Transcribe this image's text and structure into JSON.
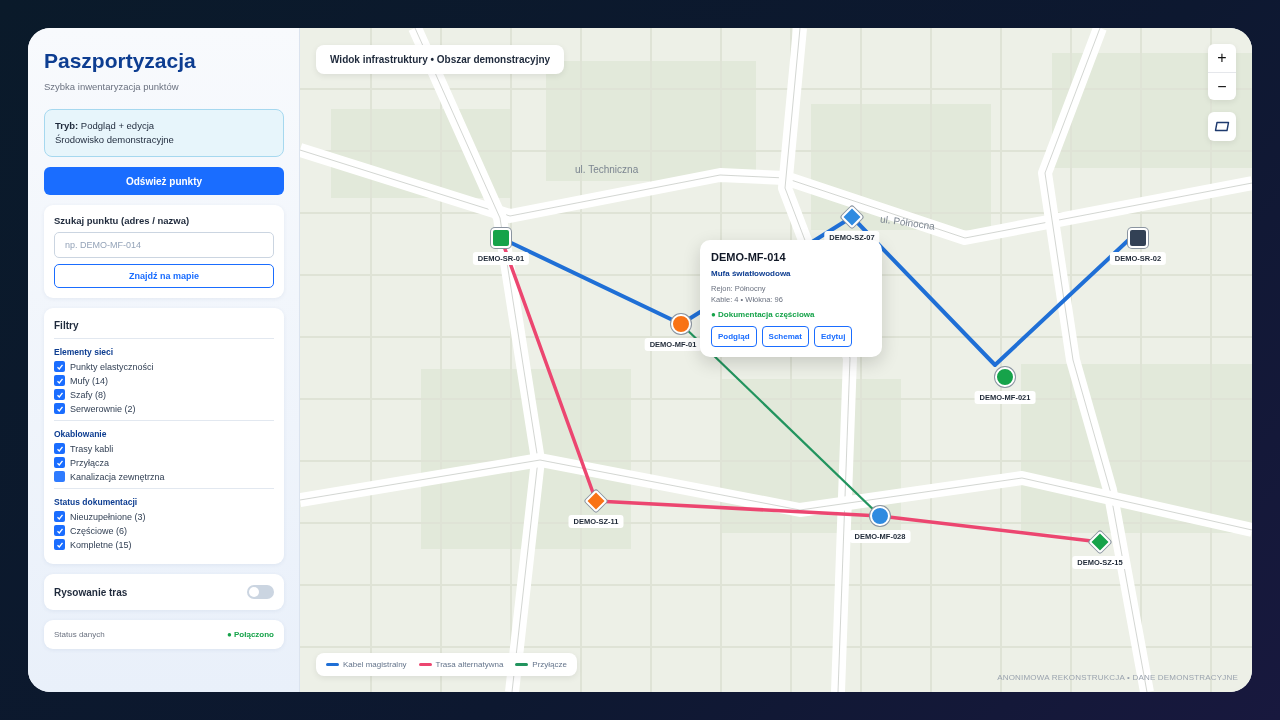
{
  "sidebar": {
    "title": "Paszportyzacja",
    "subtitle": "Szybka inwentaryzacja punktów",
    "mode_box": {
      "line_1": "**Tryb:** Podgląd + edycja",
      "line_2": "Środowisko demonstracyjne"
    },
    "refresh_button": "Odśwież punkty",
    "search": {
      "label": "Szukaj punktu (adres / nazwa)",
      "placeholder": "np. DEMO-MF-014",
      "button": "Znajdź na mapie"
    },
    "filters": {
      "title": "Filtry",
      "groups": [
        {
          "title": "Elementy sieci",
          "items": [
            {
              "label": "Punkty elastyczności",
              "checked": true
            },
            {
              "label": "Mufy (14)",
              "checked": true
            },
            {
              "label": "Szafy (8)",
              "checked": true
            },
            {
              "label": "Serwerownie (2)",
              "checked": true
            }
          ]
        },
        {
          "title": "Okablowanie",
          "items": [
            {
              "label": "Trasy kabli",
              "checked": true
            },
            {
              "label": "Przyłącza",
              "checked": true
            },
            {
              "label": "Kanalizacja zewnętrzna",
              "checked": false
            }
          ]
        },
        {
          "title": "Status dokumentacji",
          "items": [
            {
              "label": "Nieuzupełnione (3)",
              "checked": true
            },
            {
              "label": "Częściowe (6)",
              "checked": true
            },
            {
              "label": "Kompletne (15)",
              "checked": true
            }
          ]
        }
      ]
    },
    "route_drawing": {
      "label": "Rysowanie tras",
      "on": false
    },
    "data_status": {
      "label": "Status danych",
      "value": "● Połączono"
    }
  },
  "map": {
    "title_chip": "Widok infrastruktury • Obszar demonstracyjny",
    "street_labels": [
      "ul. Techniczna",
      "ul. Północna"
    ],
    "markers": [
      {
        "label": "DEMO-SR-01",
        "kind": "square",
        "color": "#16a34a"
      },
      {
        "label": "DEMO-MF-01",
        "kind": "circle",
        "color": "#f97316"
      },
      {
        "label": "DEMO-SZ-07",
        "kind": "diamond",
        "color": "#2f8be0"
      },
      {
        "label": "DEMO-SR-02",
        "kind": "square",
        "color": "#334155"
      },
      {
        "label": "DEMO-MF-021",
        "kind": "circle",
        "color": "#16a34a"
      },
      {
        "label": "DEMO-SZ-11",
        "kind": "diamond",
        "color": "#f97316"
      },
      {
        "label": "DEMO-MF-028",
        "kind": "circle",
        "color": "#2f8be0"
      },
      {
        "label": "DEMO-SZ-15",
        "kind": "diamond",
        "color": "#16a34a"
      }
    ],
    "popup": {
      "title": "DEMO-MF-014",
      "subtitle": "Mufa światłowodowa",
      "lines": [
        "Rejon: Północny",
        "Kable: 4 • Włókna: 96"
      ],
      "status": "● Dokumentacja częściowa",
      "buttons": [
        "Podgląd",
        "Schemat",
        "Edytuj"
      ]
    },
    "zoom_in": "+",
    "zoom_out": "−",
    "legend": [
      {
        "label": "Kabel magistralny",
        "color": "#1f6fd6"
      },
      {
        "label": "Trasa alternatywna",
        "color": "#ec4670"
      },
      {
        "label": "Przyłącze",
        "color": "#22945e"
      }
    ],
    "attribution": "ANONIMOWA REKONSTRUKCJA • DANE DEMONSTRACYJNE"
  }
}
